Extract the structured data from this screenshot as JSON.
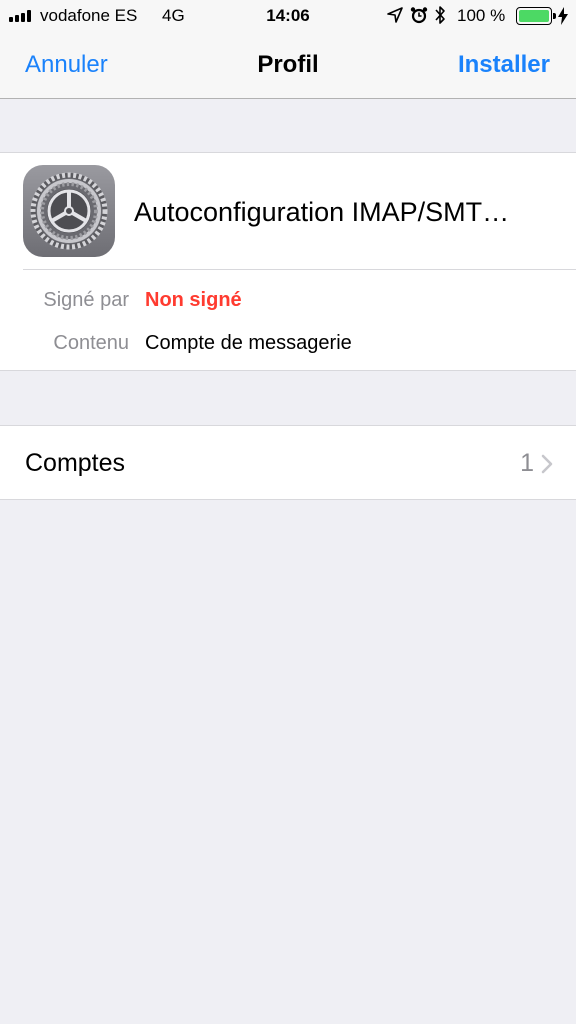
{
  "status_bar": {
    "carrier": "vodafone ES",
    "network": "4G",
    "time": "14:06",
    "battery_percent": "100 %",
    "battery_level": 1.0,
    "icons": [
      "signal-bars-icon",
      "location-icon",
      "alarm-icon",
      "bluetooth-icon",
      "battery-icon",
      "charging-icon"
    ]
  },
  "nav": {
    "cancel_label": "Annuler",
    "title": "Profil",
    "install_label": "Installer"
  },
  "profile": {
    "name": "Autoconfiguration IMAP/SMT…",
    "icon": "settings-gear-icon",
    "signed_by_label": "Signé par",
    "signed_by_value": "Non signé",
    "content_label": "Contenu",
    "content_value": "Compte de messagerie"
  },
  "accounts": {
    "label": "Comptes",
    "count": "1"
  },
  "colors": {
    "accent": "#1a82fb",
    "warning": "#ff3b30",
    "battery": "#4cd964",
    "background": "#efeff4"
  }
}
